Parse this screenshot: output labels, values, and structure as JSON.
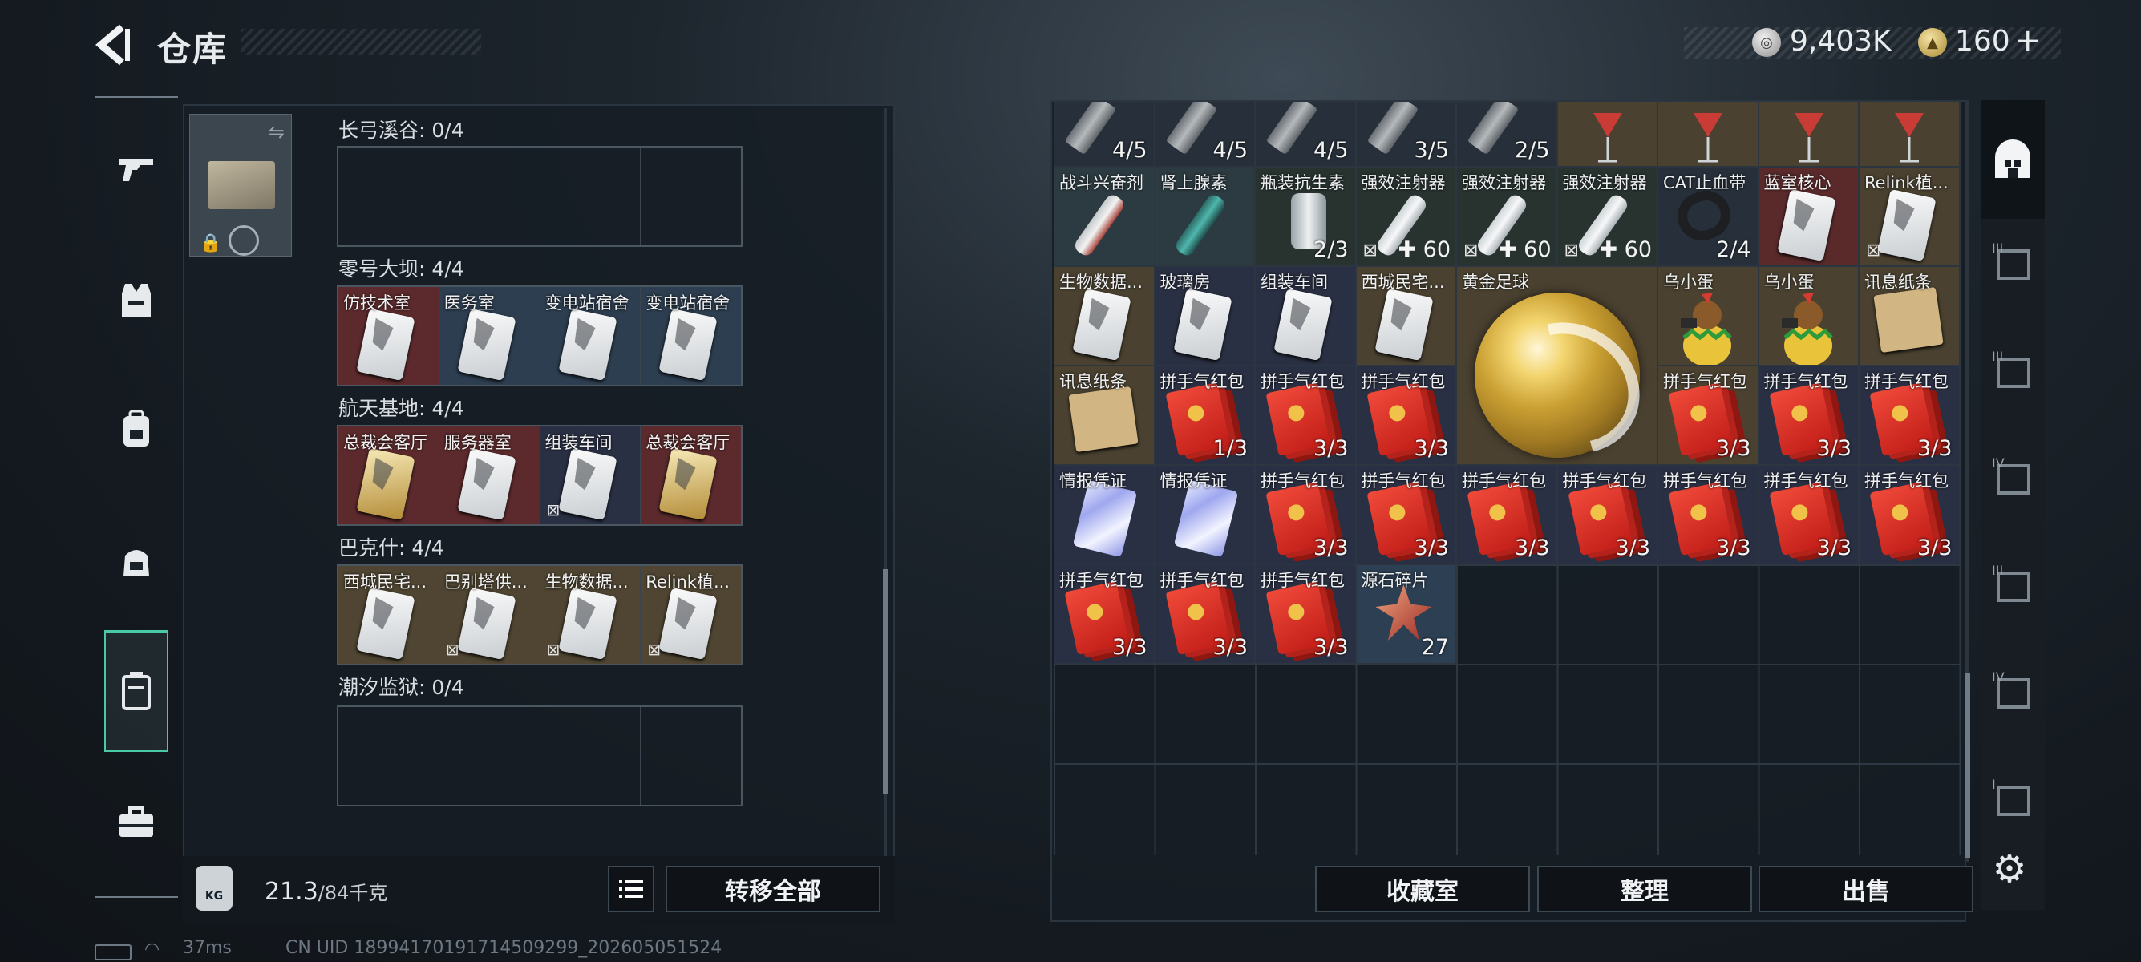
{
  "header": {
    "title": "仓库",
    "silver": "9,403K",
    "gold": "160",
    "gold_add": "+"
  },
  "left_rail": {
    "items": [
      "weapon-icon",
      "armor-vest-icon",
      "backpack-icon",
      "bag-icon",
      "locker-icon",
      "toolbox-icon"
    ]
  },
  "left_sections": [
    {
      "title": "长弓溪谷: 0/4",
      "cells": []
    },
    {
      "title": "零号大坝: 4/4",
      "cells": [
        {
          "label": "仿技术室",
          "bg": "red"
        },
        {
          "label": "医务室",
          "bg": "blue"
        },
        {
          "label": "变电站宿舍",
          "bg": "blue"
        },
        {
          "label": "变电站宿舍",
          "bg": "blue"
        }
      ]
    },
    {
      "title": "航天基地: 4/4",
      "cells": [
        {
          "label": "总裁会客厅",
          "bg": "red",
          "gold": true
        },
        {
          "label": "服务器室",
          "bg": "red"
        },
        {
          "label": "组装车间",
          "bg": "navy",
          "locked": true
        },
        {
          "label": "总裁会客厅",
          "bg": "red",
          "gold": true
        }
      ]
    },
    {
      "title": "巴克什: 4/4",
      "cells": [
        {
          "label": "西城民宅...",
          "bg": "gold"
        },
        {
          "label": "巴别塔供...",
          "bg": "gold",
          "locked": true
        },
        {
          "label": "生物数据...",
          "bg": "gold",
          "locked": true
        },
        {
          "label": "Relink植...",
          "bg": "gold",
          "locked": true
        }
      ]
    },
    {
      "title": "潮汐监狱: 0/4",
      "cells": []
    }
  ],
  "weight": {
    "current": "21.3",
    "max": "/84千克",
    "kg": "KG"
  },
  "buttons": {
    "transfer_all": "转移全部",
    "collection": "收藏室",
    "organize": "整理",
    "sell": "出售"
  },
  "grid_items": [
    {
      "kind": "ammo",
      "count": "4/5",
      "bg": "dk"
    },
    {
      "kind": "ammo",
      "count": "4/5",
      "bg": "dk"
    },
    {
      "kind": "ammo",
      "count": "4/5",
      "bg": "dk"
    },
    {
      "kind": "ammo",
      "count": "3/5",
      "bg": "dk"
    },
    {
      "kind": "ammo",
      "count": "2/5",
      "bg": "dk"
    },
    {
      "kind": "glass",
      "bg": "gd"
    },
    {
      "kind": "glass",
      "bg": "gd"
    },
    {
      "kind": "glass",
      "bg": "gd"
    },
    {
      "kind": "glass",
      "bg": "gd"
    },
    {
      "label": "战斗兴奋剂",
      "kind": "syr-red",
      "bg": "tl"
    },
    {
      "label": "肾上腺素",
      "kind": "syr-teal",
      "bg": "tl"
    },
    {
      "label": "瓶装抗生素",
      "kind": "bottle",
      "count": "2/3",
      "bg": "gr"
    },
    {
      "label": "强效注射器",
      "kind": "syr",
      "heal": "✚ 60",
      "locked": true,
      "bg": "gr"
    },
    {
      "label": "强效注射器",
      "kind": "syr",
      "heal": "✚ 60",
      "locked": true,
      "bg": "gr"
    },
    {
      "label": "强效注射器",
      "kind": "syr",
      "heal": "✚ 60",
      "locked": true,
      "bg": "gr"
    },
    {
      "label": "CAT止血带",
      "kind": "tourn",
      "count": "2/4",
      "bg": "dk"
    },
    {
      "label": "蓝室核心",
      "kind": "card",
      "bg": "rd"
    },
    {
      "label": "Relink植...",
      "kind": "card",
      "locked": true,
      "bg": "gd"
    },
    {
      "label": "生物数据...",
      "kind": "card",
      "bg": "gd"
    },
    {
      "label": "玻璃房",
      "kind": "card",
      "bg": "nv"
    },
    {
      "label": "组装车间",
      "kind": "card",
      "bg": "nv"
    },
    {
      "label": "西城民宅...",
      "kind": "card",
      "bg": "gd"
    },
    {
      "label": "乌小蛋",
      "kind": "egg",
      "bg": "gd"
    },
    {
      "label": "乌小蛋",
      "kind": "egg",
      "bg": "gd"
    },
    {
      "label": "讯息纸条",
      "kind": "env",
      "bg": "gd"
    },
    {
      "label": "讯息纸条",
      "kind": "env",
      "bg": "gd"
    },
    {
      "label": "拼手气红包",
      "kind": "rp",
      "count": "1/3",
      "bg": "nv"
    },
    {
      "label": "拼手气红包",
      "kind": "rp",
      "count": "3/3",
      "bg": "nv"
    },
    {
      "label": "拼手气红包",
      "kind": "rp",
      "count": "3/3",
      "bg": "nv"
    },
    {
      "label": "拼手气红包",
      "kind": "rp",
      "count": "3/3",
      "bg": "gd"
    },
    {
      "label": "拼手气红包",
      "kind": "rp",
      "count": "3/3",
      "bg": "nv"
    },
    {
      "label": "拼手气红包",
      "kind": "rp",
      "count": "3/3",
      "bg": "nv"
    },
    {
      "label": "情报凭证",
      "kind": "holo",
      "bg": "nv"
    },
    {
      "label": "情报凭证",
      "kind": "holo",
      "bg": "nv"
    },
    {
      "label": "拼手气红包",
      "kind": "rp",
      "count": "3/3",
      "bg": "nv"
    },
    {
      "label": "拼手气红包",
      "kind": "rp",
      "count": "3/3",
      "bg": "nv"
    },
    {
      "label": "拼手气红包",
      "kind": "rp",
      "count": "3/3",
      "bg": "nv"
    },
    {
      "label": "拼手气红包",
      "kind": "rp",
      "count": "3/3",
      "bg": "nv"
    },
    {
      "label": "拼手气红包",
      "kind": "rp",
      "count": "3/3",
      "bg": "nv"
    },
    {
      "label": "拼手气红包",
      "kind": "rp",
      "count": "3/3",
      "bg": "nv"
    },
    {
      "label": "拼手气红包",
      "kind": "rp",
      "count": "3/3",
      "bg": "nv"
    },
    {
      "label": "拼手气红包",
      "kind": "rp",
      "count": "3/3",
      "bg": "nv"
    },
    {
      "label": "拼手气红包",
      "kind": "rp",
      "count": "3/3",
      "bg": "nv"
    },
    {
      "label": "拼手气红包",
      "kind": "rp",
      "count": "3/3",
      "bg": "nv"
    },
    {
      "label": "源石碎片",
      "kind": "shard",
      "count": "27",
      "bg": "bl"
    }
  ],
  "gold_ball": {
    "label": "黄金足球"
  },
  "right_rail": {
    "items": [
      "home-icon",
      "tier-III-icon",
      "tier-III-icon",
      "tier-IV-icon",
      "tier-III-icon",
      "tier-IV-icon",
      "tier-I-icon"
    ],
    "labels": [
      "",
      "III",
      "III",
      "IV",
      "III",
      "IV",
      "I"
    ]
  },
  "footer": {
    "ping": "37ms",
    "uid": "CN UID 18994170191714509299_202605051524"
  }
}
